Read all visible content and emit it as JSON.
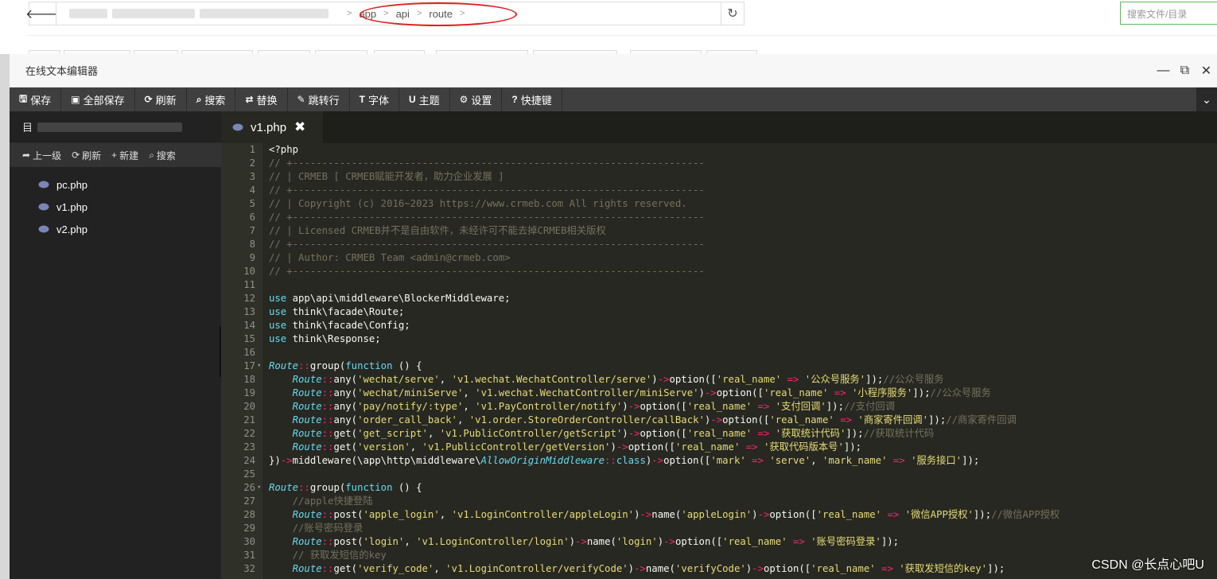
{
  "file_manager": {
    "back_icon": "arrow-left-icon",
    "breadcrumb": [
      "app",
      "api",
      "route"
    ],
    "search_placeholder": "搜索文件/目录",
    "highlight_color": "#e02020"
  },
  "editor": {
    "title": "在线文本编辑器",
    "toolbar": [
      {
        "icon": "save-icon",
        "glyph": "🖫",
        "label": "保存"
      },
      {
        "icon": "save-all-icon",
        "glyph": "▣",
        "label": "全部保存"
      },
      {
        "icon": "refresh-icon",
        "glyph": "⟳",
        "label": "刷新"
      },
      {
        "icon": "search-icon",
        "glyph": "⌕",
        "label": "搜索"
      },
      {
        "icon": "replace-icon",
        "glyph": "⇄",
        "label": "替换"
      },
      {
        "icon": "goto-line-icon",
        "glyph": "✎",
        "label": "跳转行"
      },
      {
        "icon": "font-icon",
        "glyph": "T",
        "label": "字体"
      },
      {
        "icon": "theme-icon",
        "glyph": "U",
        "label": "主题"
      },
      {
        "icon": "settings-icon",
        "glyph": "⚙",
        "label": "设置"
      },
      {
        "icon": "help-icon",
        "glyph": "?",
        "label": "快捷键"
      }
    ],
    "sidebar": {
      "dir_label": "目",
      "tools": [
        {
          "icon": "up-level-icon",
          "glyph": "➦",
          "label": "上一级"
        },
        {
          "icon": "refresh-icon",
          "glyph": "⟳",
          "label": "刷新"
        },
        {
          "icon": "plus-icon",
          "glyph": "+",
          "label": "新建"
        },
        {
          "icon": "search-icon",
          "glyph": "⌕",
          "label": "搜索"
        }
      ],
      "files": [
        "pc.php",
        "v1.php",
        "v2.php"
      ]
    },
    "tab": {
      "name": "v1.php",
      "close_glyph": "✖"
    },
    "colors": {
      "background": "#272822",
      "keyword": "#66d9ef",
      "string": "#e6db74",
      "comment": "#75715e",
      "operator": "#f92672"
    }
  },
  "code_lines": [
    {
      "n": "1",
      "fold": "",
      "t": [
        [
          "",
          "<?php"
        ]
      ]
    },
    {
      "n": "2",
      "fold": "",
      "t": [
        [
          "c",
          "// +----------------------------------------------------------------------"
        ]
      ]
    },
    {
      "n": "3",
      "fold": "",
      "t": [
        [
          "c",
          "// | CRMEB [ CRMEB赋能开发者，助力企业发展 ]"
        ]
      ]
    },
    {
      "n": "4",
      "fold": "",
      "t": [
        [
          "c",
          "// +----------------------------------------------------------------------"
        ]
      ]
    },
    {
      "n": "5",
      "fold": "",
      "t": [
        [
          "c",
          "// | Copyright (c) 2016~2023 https://www.crmeb.com All rights reserved."
        ]
      ]
    },
    {
      "n": "6",
      "fold": "",
      "t": [
        [
          "c",
          "// +----------------------------------------------------------------------"
        ]
      ]
    },
    {
      "n": "7",
      "fold": "",
      "t": [
        [
          "c",
          "// | Licensed CRMEB并不是自由软件，未经许可不能去掉CRMEB相关版权"
        ]
      ]
    },
    {
      "n": "8",
      "fold": "",
      "t": [
        [
          "c",
          "// +----------------------------------------------------------------------"
        ]
      ]
    },
    {
      "n": "9",
      "fold": "",
      "t": [
        [
          "c",
          "// | Author: CRMEB Team <admin@crmeb.com>"
        ]
      ]
    },
    {
      "n": "10",
      "fold": "",
      "t": [
        [
          "c",
          "// +----------------------------------------------------------------------"
        ]
      ]
    },
    {
      "n": "11",
      "fold": "",
      "t": []
    },
    {
      "n": "12",
      "fold": "",
      "t": [
        [
          "k",
          "use"
        ],
        [
          "",
          " app\\api\\middleware\\BlockerMiddleware;"
        ]
      ]
    },
    {
      "n": "13",
      "fold": "",
      "t": [
        [
          "k",
          "use"
        ],
        [
          "",
          " think\\facade\\Route;"
        ]
      ]
    },
    {
      "n": "14",
      "fold": "",
      "t": [
        [
          "k",
          "use"
        ],
        [
          "",
          " think\\facade\\Config;"
        ]
      ]
    },
    {
      "n": "15",
      "fold": "",
      "t": [
        [
          "k",
          "use"
        ],
        [
          "",
          " think\\Response;"
        ]
      ]
    },
    {
      "n": "16",
      "fold": "",
      "t": []
    },
    {
      "n": "17",
      "fold": "▾",
      "t": [
        [
          "r",
          "Route"
        ],
        [
          "o",
          "::"
        ],
        [
          "",
          "group("
        ],
        [
          "k",
          "function"
        ],
        [
          "",
          " () {"
        ]
      ]
    },
    {
      "n": "18",
      "fold": "",
      "t": [
        [
          "",
          "    "
        ],
        [
          "r",
          "Route"
        ],
        [
          "o",
          "::"
        ],
        [
          "",
          "any("
        ],
        [
          "s",
          "'wechat/serve'"
        ],
        [
          "",
          ", "
        ],
        [
          "s",
          "'v1.wechat.WechatController/serve'"
        ],
        [
          "",
          ")"
        ],
        [
          "o",
          "->"
        ],
        [
          "",
          "option(["
        ],
        [
          "s",
          "'real_name'"
        ],
        [
          "o",
          " => "
        ],
        [
          "s",
          "'公众号服务'"
        ],
        [
          "",
          "]);"
        ],
        [
          "c",
          "//公众号服务"
        ]
      ]
    },
    {
      "n": "19",
      "fold": "",
      "t": [
        [
          "",
          "    "
        ],
        [
          "r",
          "Route"
        ],
        [
          "o",
          "::"
        ],
        [
          "",
          "any("
        ],
        [
          "s",
          "'wechat/miniServe'"
        ],
        [
          "",
          ", "
        ],
        [
          "s",
          "'v1.wechat.WechatController/miniServe'"
        ],
        [
          "",
          ")"
        ],
        [
          "o",
          "->"
        ],
        [
          "",
          "option(["
        ],
        [
          "s",
          "'real_name'"
        ],
        [
          "o",
          " => "
        ],
        [
          "s",
          "'小程序服务'"
        ],
        [
          "",
          "]);"
        ],
        [
          "c",
          "//公众号服务"
        ]
      ]
    },
    {
      "n": "20",
      "fold": "",
      "t": [
        [
          "",
          "    "
        ],
        [
          "r",
          "Route"
        ],
        [
          "o",
          "::"
        ],
        [
          "",
          "any("
        ],
        [
          "s",
          "'pay/notify/:type'"
        ],
        [
          "",
          ", "
        ],
        [
          "s",
          "'v1.PayController/notify'"
        ],
        [
          "",
          ")"
        ],
        [
          "o",
          "->"
        ],
        [
          "",
          "option(["
        ],
        [
          "s",
          "'real_name'"
        ],
        [
          "o",
          " => "
        ],
        [
          "s",
          "'支付回调'"
        ],
        [
          "",
          "]);"
        ],
        [
          "c",
          "//支付回调"
        ]
      ]
    },
    {
      "n": "21",
      "fold": "",
      "t": [
        [
          "",
          "    "
        ],
        [
          "r",
          "Route"
        ],
        [
          "o",
          "::"
        ],
        [
          "",
          "any("
        ],
        [
          "s",
          "'order_call_back'"
        ],
        [
          "",
          ", "
        ],
        [
          "s",
          "'v1.order.StoreOrderController/callBack'"
        ],
        [
          "",
          ")"
        ],
        [
          "o",
          "->"
        ],
        [
          "",
          "option(["
        ],
        [
          "s",
          "'real_name'"
        ],
        [
          "o",
          " => "
        ],
        [
          "s",
          "'商家寄件回调'"
        ],
        [
          "",
          "]);"
        ],
        [
          "c",
          "//商家寄件回调"
        ]
      ]
    },
    {
      "n": "22",
      "fold": "",
      "t": [
        [
          "",
          "    "
        ],
        [
          "r",
          "Route"
        ],
        [
          "o",
          "::"
        ],
        [
          "",
          "get("
        ],
        [
          "s",
          "'get_script'"
        ],
        [
          "",
          ", "
        ],
        [
          "s",
          "'v1.PublicController/getScript'"
        ],
        [
          "",
          ")"
        ],
        [
          "o",
          "->"
        ],
        [
          "",
          "option(["
        ],
        [
          "s",
          "'real_name'"
        ],
        [
          "o",
          " => "
        ],
        [
          "s",
          "'获取统计代码'"
        ],
        [
          "",
          "]);"
        ],
        [
          "c",
          "//获取统计代码"
        ]
      ]
    },
    {
      "n": "23",
      "fold": "",
      "t": [
        [
          "",
          "    "
        ],
        [
          "r",
          "Route"
        ],
        [
          "o",
          "::"
        ],
        [
          "",
          "get("
        ],
        [
          "s",
          "'version'"
        ],
        [
          "",
          ", "
        ],
        [
          "s",
          "'v1.PublicController/getVersion'"
        ],
        [
          "",
          ")"
        ],
        [
          "o",
          "->"
        ],
        [
          "",
          "option(["
        ],
        [
          "s",
          "'real_name'"
        ],
        [
          "o",
          " => "
        ],
        [
          "s",
          "'获取代码版本号'"
        ],
        [
          "",
          "]);"
        ]
      ]
    },
    {
      "n": "24",
      "fold": "",
      "t": [
        [
          "",
          "})"
        ],
        [
          "o",
          "->"
        ],
        [
          "",
          "middleware(\\app\\http\\middleware\\"
        ],
        [
          "r",
          "AllowOriginMiddleware"
        ],
        [
          "o",
          "::"
        ],
        [
          "k",
          "class"
        ],
        [
          "",
          ")"
        ],
        [
          "o",
          "->"
        ],
        [
          "",
          "option(["
        ],
        [
          "s",
          "'mark'"
        ],
        [
          "o",
          " => "
        ],
        [
          "s",
          "'serve'"
        ],
        [
          "",
          ", "
        ],
        [
          "s",
          "'mark_name'"
        ],
        [
          "o",
          " => "
        ],
        [
          "s",
          "'服务接口'"
        ],
        [
          "",
          "]);"
        ]
      ]
    },
    {
      "n": "25",
      "fold": "",
      "t": []
    },
    {
      "n": "26",
      "fold": "▾",
      "t": [
        [
          "r",
          "Route"
        ],
        [
          "o",
          "::"
        ],
        [
          "",
          "group("
        ],
        [
          "k",
          "function"
        ],
        [
          "",
          " () {"
        ]
      ]
    },
    {
      "n": "27",
      "fold": "",
      "t": [
        [
          "",
          "    "
        ],
        [
          "c",
          "//apple快捷登陆"
        ]
      ]
    },
    {
      "n": "28",
      "fold": "",
      "t": [
        [
          "",
          "    "
        ],
        [
          "r",
          "Route"
        ],
        [
          "o",
          "::"
        ],
        [
          "",
          "post("
        ],
        [
          "s",
          "'apple_login'"
        ],
        [
          "",
          ", "
        ],
        [
          "s",
          "'v1.LoginController/appleLogin'"
        ],
        [
          "",
          ")"
        ],
        [
          "o",
          "->"
        ],
        [
          "",
          "name("
        ],
        [
          "s",
          "'appleLogin'"
        ],
        [
          "",
          ")"
        ],
        [
          "o",
          "->"
        ],
        [
          "",
          "option(["
        ],
        [
          "s",
          "'real_name'"
        ],
        [
          "o",
          " => "
        ],
        [
          "s",
          "'微信APP授权'"
        ],
        [
          "",
          "]);"
        ],
        [
          "c",
          "//微信APP授权"
        ]
      ]
    },
    {
      "n": "29",
      "fold": "",
      "t": [
        [
          "",
          "    "
        ],
        [
          "c",
          "//账号密码登录"
        ]
      ]
    },
    {
      "n": "30",
      "fold": "",
      "t": [
        [
          "",
          "    "
        ],
        [
          "r",
          "Route"
        ],
        [
          "o",
          "::"
        ],
        [
          "",
          "post("
        ],
        [
          "s",
          "'login'"
        ],
        [
          "",
          ", "
        ],
        [
          "s",
          "'v1.LoginController/login'"
        ],
        [
          "",
          ")"
        ],
        [
          "o",
          "->"
        ],
        [
          "",
          "name("
        ],
        [
          "s",
          "'login'"
        ],
        [
          "",
          ")"
        ],
        [
          "o",
          "->"
        ],
        [
          "",
          "option(["
        ],
        [
          "s",
          "'real_name'"
        ],
        [
          "o",
          " => "
        ],
        [
          "s",
          "'账号密码登录'"
        ],
        [
          "",
          "]);"
        ]
      ]
    },
    {
      "n": "31",
      "fold": "",
      "t": [
        [
          "",
          "    "
        ],
        [
          "c",
          "// 获取发短信的key"
        ]
      ]
    },
    {
      "n": "32",
      "fold": "",
      "t": [
        [
          "",
          "    "
        ],
        [
          "r",
          "Route"
        ],
        [
          "o",
          "::"
        ],
        [
          "",
          "get("
        ],
        [
          "s",
          "'verify_code'"
        ],
        [
          "",
          ", "
        ],
        [
          "s",
          "'v1.LoginController/verifyCode'"
        ],
        [
          "",
          ")"
        ],
        [
          "o",
          "->"
        ],
        [
          "",
          "name("
        ],
        [
          "s",
          "'verifyCode'"
        ],
        [
          "",
          ")"
        ],
        [
          "o",
          "->"
        ],
        [
          "",
          "option(["
        ],
        [
          "s",
          "'real_name'"
        ],
        [
          "o",
          " => "
        ],
        [
          "s",
          "'获取发短信的key'"
        ],
        [
          "",
          "]);"
        ]
      ]
    }
  ],
  "watermark": "CSDN @长点心吧U"
}
